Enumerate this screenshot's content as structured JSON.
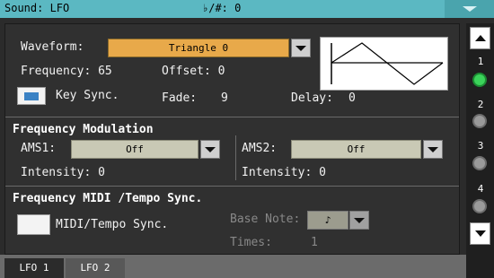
{
  "header": {
    "title": "Sound: LFO",
    "key_info": "♭/#: 0"
  },
  "lfo": {
    "waveform_label": "Waveform:",
    "waveform_value": "Triangle 0",
    "frequency_label": "Frequency: 65",
    "offset_label": "Offset: 0",
    "key_sync_label": "Key Sync.",
    "fade_label": "Fade:",
    "fade_value": "9",
    "delay_label": "Delay:",
    "delay_value": "0"
  },
  "freq_mod": {
    "title": "Frequency Modulation",
    "ams1_label": "AMS1:",
    "ams1_value": "Off",
    "intensity1_label": "Intensity: 0",
    "ams2_label": "AMS2:",
    "ams2_value": "Off",
    "intensity2_label": "Intensity: 0"
  },
  "midi_sync": {
    "title": "Frequency MIDI /Tempo Sync.",
    "midi_tempo_label": "MIDI/Tempo Sync.",
    "base_note_label": "Base Note:",
    "base_note_value": "♪",
    "times_label": "Times:",
    "times_value": "1"
  },
  "scroller": {
    "pages": [
      "1",
      "2",
      "3",
      "4"
    ],
    "active_page": "1"
  },
  "tabs": [
    "LFO 1",
    "LFO 2"
  ],
  "active_tab": "LFO 1",
  "colors": {
    "header": "#5bb8c2",
    "selected_field": "#e8a94a",
    "page_dot_active": "#3bd35a",
    "checkbox_on": "#3b82c4"
  }
}
